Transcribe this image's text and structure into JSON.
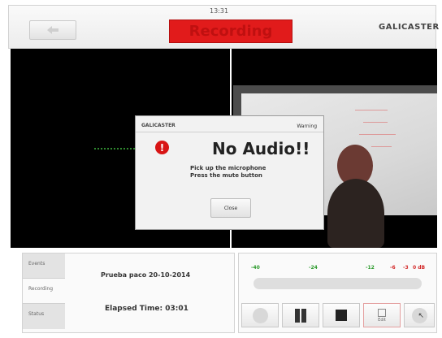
{
  "header": {
    "clock": "13:31",
    "status_banner": "Recording",
    "brand": "GALICASTER",
    "back_icon": "left-arrow-icon"
  },
  "dialog": {
    "brand": "GALICASTER",
    "kind": "Warning",
    "title": "No Audio!!",
    "message_line1": "Pick up the microphone",
    "message_line2": "Press the mute button",
    "close_label": "Close",
    "alert_icon_glyph": "!"
  },
  "panel": {
    "tabs": [
      "Events",
      "Recording",
      "Status"
    ],
    "active_tab": "Recording",
    "event_name": "Prueba paco 20-10-2014",
    "elapsed": "Elapsed Time: 03:01"
  },
  "audio_meter": {
    "labels": [
      "-40",
      "-24",
      "-12",
      "-6",
      "-3",
      "0 dB"
    ],
    "colors": {
      "green": "#2b9a2b",
      "red": "#d32a2a"
    },
    "level": 0
  },
  "controls": {
    "edit_label": "Edit"
  },
  "colors": {
    "recording_red": "#e11b1b",
    "panel_bg": "#fafafa"
  }
}
